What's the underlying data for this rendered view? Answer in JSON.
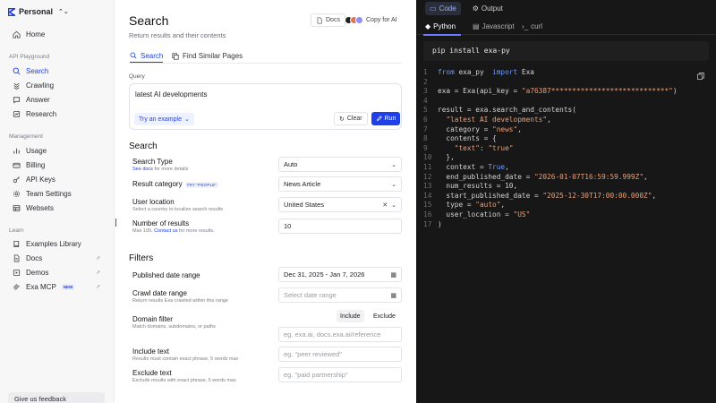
{
  "sidebar": {
    "workspace": "Personal",
    "home": "Home",
    "section_playground": "API Playground",
    "playground": [
      "Search",
      "Crawling",
      "Answer",
      "Research"
    ],
    "section_management": "Management",
    "management": [
      "Usage",
      "Billing",
      "API Keys",
      "Team Settings",
      "Websets"
    ],
    "section_learn": "Learn",
    "learn": [
      "Examples Library",
      "Docs",
      "Demos",
      "Exa MCP"
    ],
    "new_badge": "NEW",
    "feedback": "Give us feedback"
  },
  "main": {
    "title": "Search",
    "subtitle": "Return results and their contents",
    "docs_button": "Docs",
    "copy_ai": "Copy for AI",
    "tabs": [
      "Search",
      "Find Similar Pages"
    ],
    "query_label": "Query",
    "query_value": "latest AI developments",
    "try_example": "Try an example",
    "clear": "Clear",
    "run": "Run",
    "search_heading": "Search",
    "search_type": {
      "label": "Search Type",
      "hint_link": "See docs",
      "hint_rest": " for more details",
      "value": "Auto"
    },
    "result_category": {
      "label": "Result category",
      "tag": "TRY \"PEOPLE\"",
      "value": "News Article"
    },
    "user_location": {
      "label": "User location",
      "hint": "Select a country to localize search results",
      "value": "United States"
    },
    "num_results": {
      "label": "Number of results",
      "hint_pre": "Max 100. ",
      "hint_link": "Contact us",
      "hint_post": " for more results.",
      "value": "10"
    },
    "filters_heading": "Filters",
    "published": {
      "label": "Published date range",
      "value": "Dec 31, 2025 - Jan 7, 2026"
    },
    "crawl": {
      "label": "Crawl date range",
      "hint": "Return results Exa crawled within this range",
      "placeholder": "Select date range"
    },
    "domain": {
      "label": "Domain filter",
      "hint": "Match domains, subdomains, or paths",
      "include": "Include",
      "exclude": "Exclude",
      "placeholder": "eg. exa.ai, docs.exa.ai/reference"
    },
    "include_text": {
      "label": "Include text",
      "hint": "Results must contain exact phrase, 5 words max",
      "placeholder": "eg. \"peer reviewed\""
    },
    "exclude_text": {
      "label": "Exclude text",
      "hint": "Exclude results with exact phrase, 5 words max",
      "placeholder": "eg. \"paid partnership\""
    }
  },
  "code_panel": {
    "tabs": [
      "Code",
      "Output"
    ],
    "languages": [
      "Python",
      "Javascript",
      "curl"
    ],
    "install": "pip install exa-py",
    "line_numbers": [
      "1",
      "2",
      "3",
      "4",
      "5",
      "6",
      "7",
      "8",
      "9",
      "10",
      "11",
      "12",
      "13",
      "14",
      "15",
      "16",
      "17"
    ],
    "lines": [
      [
        [
          "kw",
          "from"
        ],
        [
          "",
          "exa_py"
        ],
        [
          "kw",
          "import"
        ],
        [
          "",
          "Exa"
        ]
      ],
      [],
      [
        [
          "",
          "exa = Exa(api_key = "
        ],
        [
          "str",
          "\"a76387****************************\""
        ],
        [
          "",
          ")"
        ]
      ],
      [],
      [
        [
          "",
          "result = exa.search_and_contents("
        ]
      ],
      [
        [
          "str",
          "  \"latest AI developments\""
        ],
        [
          "",
          ","
        ]
      ],
      [
        [
          "",
          "  category = "
        ],
        [
          "str",
          "\"news\""
        ],
        [
          "",
          ","
        ]
      ],
      [
        [
          "",
          "  contents = {"
        ]
      ],
      [
        [
          "str",
          "    \"text\""
        ],
        [
          "",
          ": "
        ],
        [
          "str",
          "\"true\""
        ]
      ],
      [
        [
          "",
          "  },"
        ]
      ],
      [
        [
          "",
          "  context = "
        ],
        [
          "kw",
          "True"
        ],
        [
          "",
          ","
        ]
      ],
      [
        [
          "",
          "  end_published_date = "
        ],
        [
          "str",
          "\"2026-01-07T16:59:59.999Z\""
        ],
        [
          "",
          ","
        ]
      ],
      [
        [
          "",
          "  num_results = 10,"
        ]
      ],
      [
        [
          "",
          "  start_published_date = "
        ],
        [
          "str",
          "\"2025-12-30T17:00:00.000Z\""
        ],
        [
          "",
          ","
        ]
      ],
      [
        [
          "",
          "  type = "
        ],
        [
          "str",
          "\"auto\""
        ],
        [
          "",
          ","
        ]
      ],
      [
        [
          "",
          "  user_location = "
        ],
        [
          "str",
          "\"US\""
        ]
      ],
      [
        [
          "",
          ")"
        ]
      ]
    ]
  },
  "colors": {
    "accent": "#1f40e8",
    "code_bg": "#171717",
    "keyword": "#6f9cff",
    "string": "#e9a07a"
  }
}
